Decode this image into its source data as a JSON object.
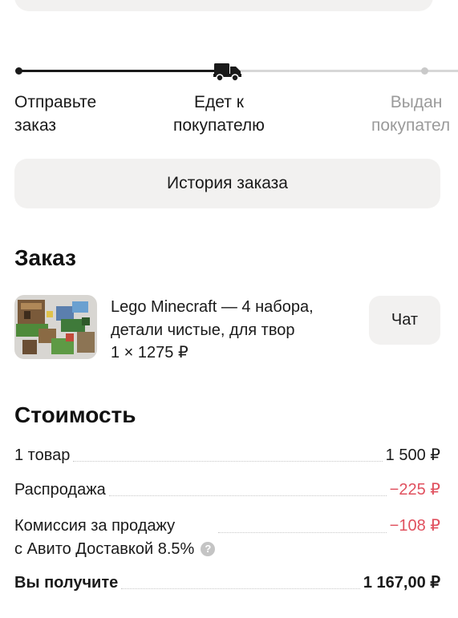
{
  "progress": {
    "steps": [
      {
        "line1": "Отправьте",
        "line2": "заказ"
      },
      {
        "line1": "Едет к",
        "line2": "покупателю"
      },
      {
        "line1": "Выдан",
        "line2": "покупател"
      }
    ],
    "current_step": 2
  },
  "history_button": "История заказа",
  "order": {
    "heading": "Заказ",
    "item_title_line1": "Lego Minecraft — 4 набора,",
    "item_title_line2": "детали чистые, для твор",
    "item_qty": "1 × 1275 ₽",
    "chat_button": "Чат"
  },
  "cost": {
    "heading": "Стоимость",
    "rows": [
      {
        "label": "1 товар",
        "value": "1 500 ₽"
      },
      {
        "label": "Распродажа",
        "value": "−225 ₽"
      },
      {
        "label_line1": "Комиссия за продажу",
        "label_line2": "с Авито Доставкой 8.5%",
        "value": "−108 ₽"
      },
      {
        "label": "Вы получите",
        "value": "1 167,00 ₽"
      }
    ]
  },
  "colors": {
    "accent_negative": "#e0505e",
    "surface": "#f2f1f0",
    "progress_done": "#1a1a1a",
    "progress_todo": "#d7d7d7"
  },
  "icons": [
    "truck-icon",
    "help-icon"
  ]
}
